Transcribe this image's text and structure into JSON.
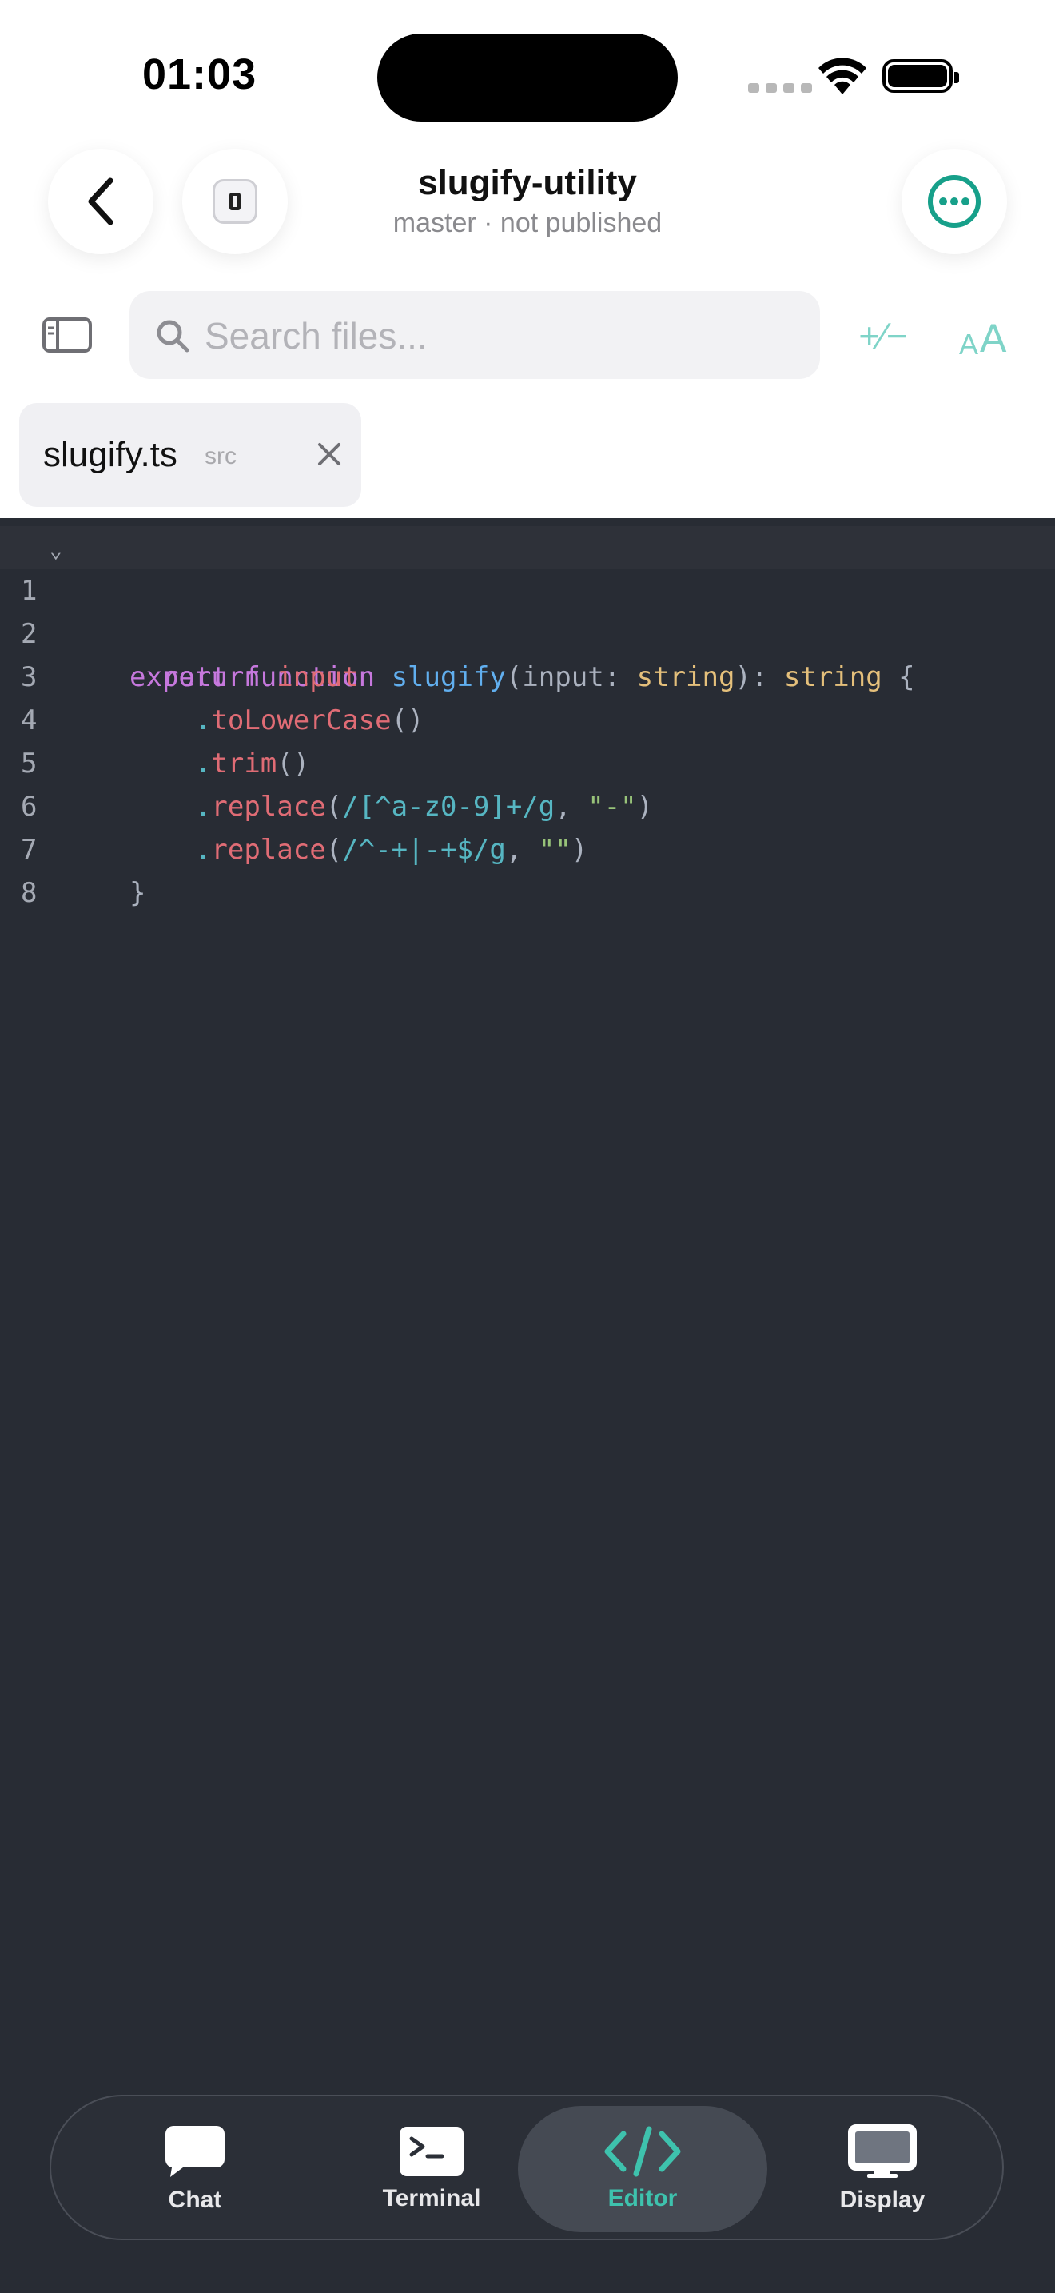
{
  "status_bar": {
    "time": "01:03"
  },
  "header": {
    "title": "slugify-utility",
    "subtitle": "master · not published"
  },
  "search": {
    "placeholder": "Search files..."
  },
  "toolbar": {
    "diff_glyph": "+∕−",
    "font_small": "A",
    "font_big": "A"
  },
  "tab": {
    "filename": "slugify.ts",
    "dir": "src"
  },
  "editor": {
    "line_numbers": [
      "1",
      "2",
      "3",
      "4",
      "5",
      "6",
      "7",
      "8"
    ],
    "lines": [
      [
        {
          "t": "export",
          "c": "kw"
        },
        {
          "t": " ",
          "c": "pl"
        },
        {
          "t": "function",
          "c": "kw"
        },
        {
          "t": " ",
          "c": "pl"
        },
        {
          "t": "slugify",
          "c": "fn"
        },
        {
          "t": "(input: ",
          "c": "pl"
        },
        {
          "t": "string",
          "c": "ty"
        },
        {
          "t": "): ",
          "c": "pl"
        },
        {
          "t": "string",
          "c": "ty"
        },
        {
          "t": " {",
          "c": "pl"
        }
      ],
      [
        {
          "t": "  ",
          "c": "pl"
        },
        {
          "t": "return",
          "c": "kw"
        },
        {
          "t": " ",
          "c": "pl"
        },
        {
          "t": "input",
          "c": "rd"
        }
      ],
      [
        {
          "t": "    ",
          "c": "pl"
        },
        {
          "t": ".",
          "c": "cy"
        },
        {
          "t": "toLowerCase",
          "c": "rd"
        },
        {
          "t": "()",
          "c": "pl"
        }
      ],
      [
        {
          "t": "    ",
          "c": "pl"
        },
        {
          "t": ".",
          "c": "cy"
        },
        {
          "t": "trim",
          "c": "rd"
        },
        {
          "t": "()",
          "c": "pl"
        }
      ],
      [
        {
          "t": "    ",
          "c": "pl"
        },
        {
          "t": ".",
          "c": "cy"
        },
        {
          "t": "replace",
          "c": "rd"
        },
        {
          "t": "(",
          "c": "pl"
        },
        {
          "t": "/[^a-z0-9]+/g",
          "c": "cy"
        },
        {
          "t": ", ",
          "c": "pl"
        },
        {
          "t": "\"-\"",
          "c": "gr"
        },
        {
          "t": ")",
          "c": "pl"
        }
      ],
      [
        {
          "t": "    ",
          "c": "pl"
        },
        {
          "t": ".",
          "c": "cy"
        },
        {
          "t": "replace",
          "c": "rd"
        },
        {
          "t": "(",
          "c": "pl"
        },
        {
          "t": "/^-+|-+$/g",
          "c": "cy"
        },
        {
          "t": ", ",
          "c": "pl"
        },
        {
          "t": "\"\"",
          "c": "gr"
        },
        {
          "t": ")",
          "c": "pl"
        }
      ],
      [
        {
          "t": "}",
          "c": "pl"
        }
      ],
      []
    ]
  },
  "nav": {
    "chat": "Chat",
    "terminal": "Terminal",
    "editor": "Editor",
    "display": "Display",
    "active": "editor"
  },
  "colors": {
    "accent": "#3ec2ad",
    "editor_bg": "#282c34",
    "keyword": "#c678dd",
    "function": "#61afef",
    "type": "#e5c07b",
    "method": "#e06c75",
    "regex": "#56b6c2",
    "string": "#98c379"
  }
}
